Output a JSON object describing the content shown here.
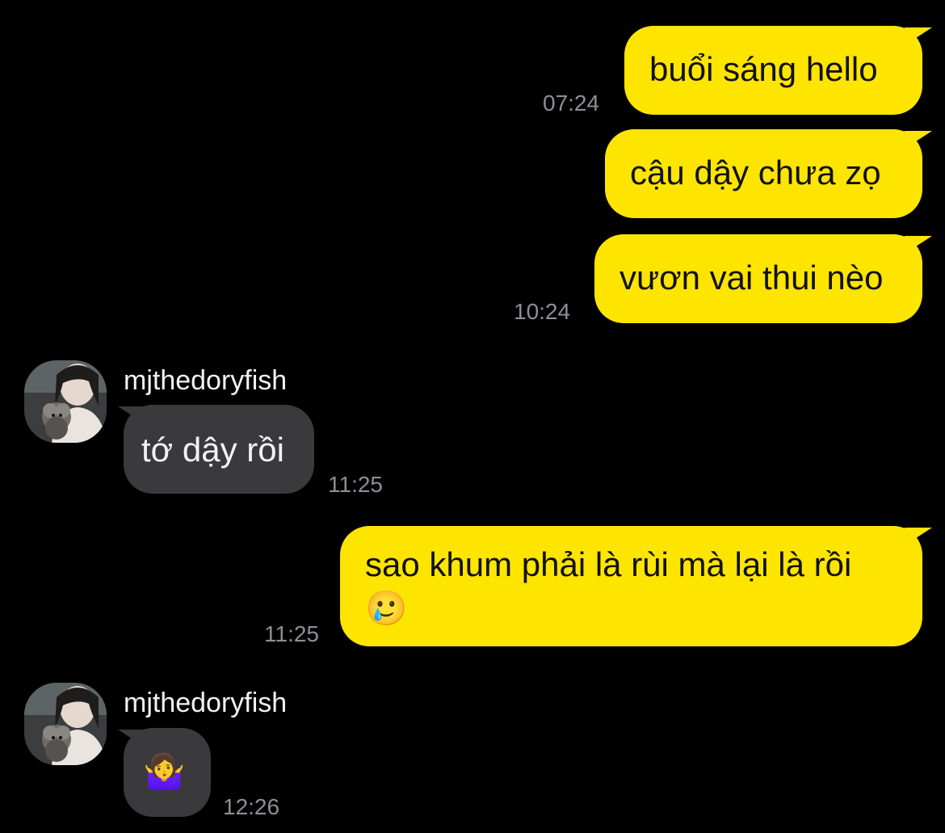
{
  "messages": [
    {
      "direction": "out",
      "text": "buổi sáng hello",
      "time": "07:24"
    },
    {
      "direction": "out",
      "text": "cậu dậy chưa zọ",
      "time": ""
    },
    {
      "direction": "out",
      "text": "vươn vai thui nèo",
      "time": "10:24"
    },
    {
      "direction": "in",
      "sender": "mjthedoryfish",
      "text": "tớ dậy rồi",
      "time": "11:25"
    },
    {
      "direction": "out",
      "text_line1": "sao khum phải là rùi mà lại là rồi",
      "text_line2": "🥲",
      "time": "11:25"
    },
    {
      "direction": "in",
      "sender": "mjthedoryfish",
      "text": "🤷‍♀️",
      "time": "12:26"
    }
  ],
  "colors": {
    "outgoing_bubble": "#FEE500",
    "incoming_bubble": "#3a3a3c",
    "background": "#000000",
    "timestamp": "#8e8e93"
  },
  "icons": {
    "avatar": "profile-photo-avatar"
  }
}
